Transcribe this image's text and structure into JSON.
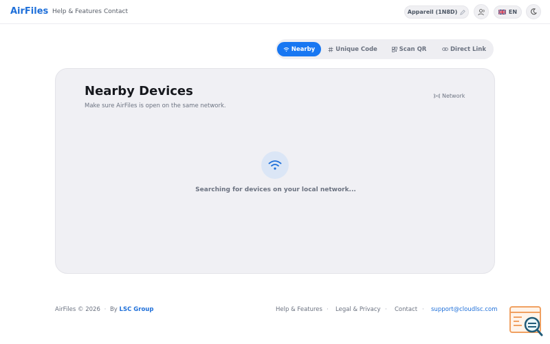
{
  "header": {
    "logo": "AirFiles",
    "nav": [
      "Help & Features",
      "Contact"
    ],
    "device_label": "Appareil (1N8D)",
    "language": "EN"
  },
  "tabs": [
    {
      "label": "Nearby",
      "icon": "wifi-icon",
      "active": true
    },
    {
      "label": "Unique Code",
      "icon": "hash-icon",
      "active": false
    },
    {
      "label": "Scan QR",
      "icon": "qr-icon",
      "active": false
    },
    {
      "label": "Direct Link",
      "icon": "link-icon",
      "active": false
    }
  ],
  "card": {
    "title": "Nearby Devices",
    "subtitle": "Make sure AirFiles is open on the same network.",
    "network_label": "Network",
    "status": "Searching for devices on your local network..."
  },
  "footer": {
    "copyright": "AirFiles © 2026",
    "by": "By",
    "company": "LSC Group",
    "links": [
      "Help & Features",
      "Legal & Privacy",
      "Contact"
    ],
    "email": "support@cloudlsc.com"
  },
  "colors": {
    "accent": "#1877f2",
    "brand": "#1e6fd9",
    "card_bg": "#f0f0f4",
    "widget_orange": "#f0a060"
  }
}
